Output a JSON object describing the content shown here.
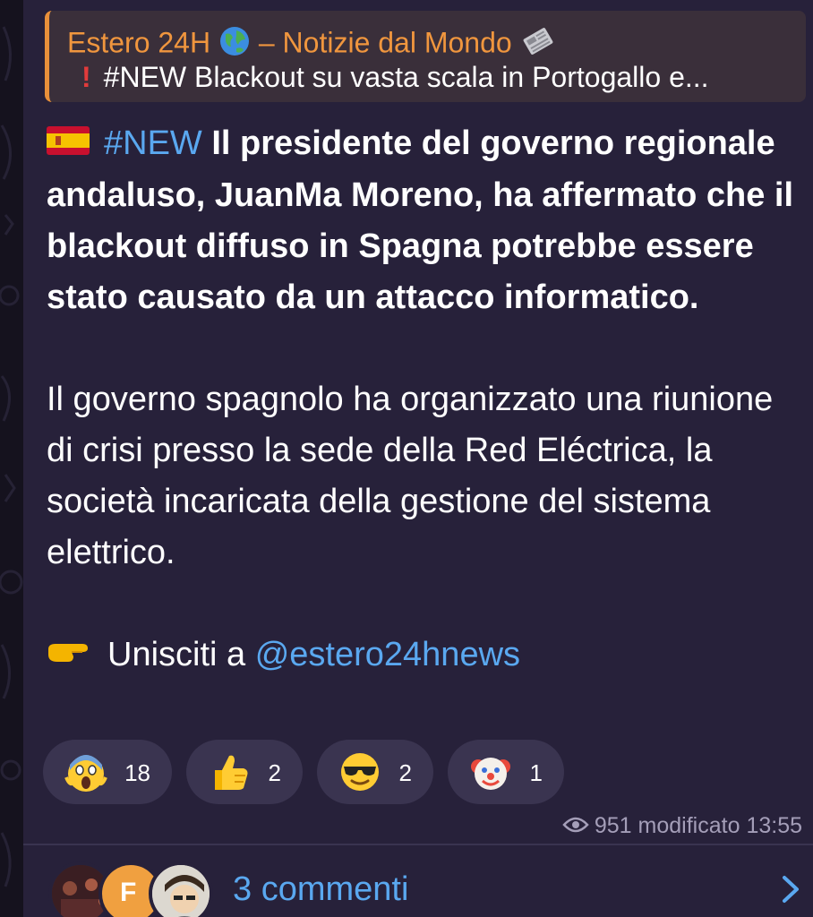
{
  "reply": {
    "channel_title": "Estero 24H",
    "channel_title_rest": "– Notizie dal Mondo",
    "quoted_text": "#NEW Blackout su vasta scala in Portogallo e..."
  },
  "message": {
    "hashtag": "#NEW",
    "headline": "Il presidente del governo regionale andaluso, JuanMa Moreno, ha affermato che il blackout diffuso in Spagna potrebbe essere stato causato da un attacco informatico.",
    "paragraph": "Il governo spagnolo ha organizzato una riunione di crisi presso la sede della Red Eléctrica, la società incaricata della gestione del sistema elettrico.",
    "join_text": "Unisciti a",
    "join_link": "@estero24hnews"
  },
  "reactions": [
    {
      "icon": "scream-face-icon",
      "count": "18"
    },
    {
      "icon": "thumbs-up-icon",
      "count": "2"
    },
    {
      "icon": "sunglasses-face-icon",
      "count": "2"
    },
    {
      "icon": "clown-face-icon",
      "count": "1"
    }
  ],
  "meta": {
    "views": "951",
    "status": "modificato",
    "time": "13:55"
  },
  "comments": {
    "label": "3 commenti",
    "avatar_letter": "F"
  },
  "colors": {
    "accent_blue": "#5aa8f0",
    "reply_orange": "#f0963e",
    "bubble_bg": "#27213a",
    "chip_bg": "#3a3450"
  }
}
